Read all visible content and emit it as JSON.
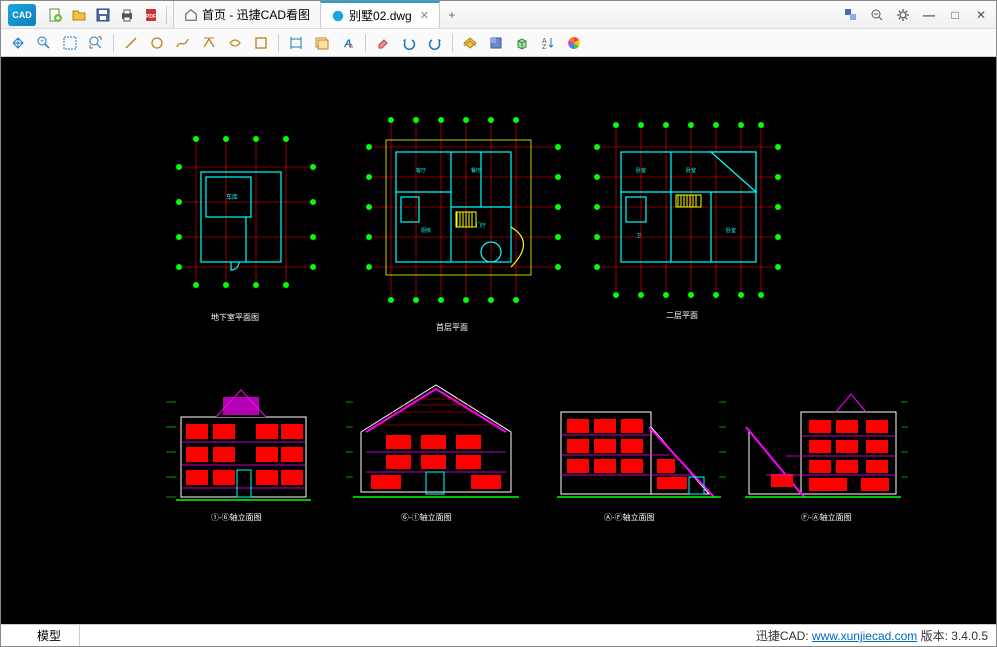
{
  "app": {
    "icon_text": "CAD"
  },
  "titlebar": {
    "new_tab": "+",
    "buttons": {
      "new": "新建",
      "open": "打开",
      "save": "保存",
      "print": "打印",
      "pdf": "PDF"
    }
  },
  "tabs": [
    {
      "label": "首页 - 迅捷CAD看图",
      "icon": "home",
      "active": false,
      "closable": false
    },
    {
      "label": "别墅02.dwg",
      "icon": "cad",
      "active": true,
      "closable": true
    }
  ],
  "window_controls": {
    "layers": "图层",
    "zoom": "缩放",
    "settings": "设置",
    "minimize": "—",
    "maximize": "□",
    "close": "✕"
  },
  "toolbar_groups": [
    [
      "move",
      "zoom-window",
      "select-window",
      "zoom-extents"
    ],
    [
      "line",
      "circle",
      "polyline",
      "rect",
      "arc",
      "ellipse"
    ],
    [
      "dim",
      "layer",
      "text"
    ],
    [
      "erase",
      "undo",
      "redo"
    ],
    [
      "hatch",
      "block",
      "3d",
      "sort",
      "color"
    ]
  ],
  "drawings": {
    "plan1_label": "地下室平面图",
    "plan2_label": "首层平面",
    "plan3_label": "二层平面",
    "elev1_label": "①-⑥轴立面图",
    "elev2_label": "⑥-①轴立面图",
    "elev3_label": "Ⓐ-Ⓕ轴立面图",
    "elev4_label": "Ⓕ-Ⓐ轴立面图"
  },
  "bottom": {
    "model_tab": "模型",
    "status_prefix": "迅捷CAD: ",
    "status_link": "www.xunjiecad.com",
    "status_suffix": " 版本: 3.4.0.5"
  },
  "colors": {
    "cyan": "#00ffff",
    "yellow": "#ffff00",
    "red": "#ff0000",
    "green": "#00ff00",
    "magenta": "#ff00ff",
    "white": "#ffffff"
  }
}
